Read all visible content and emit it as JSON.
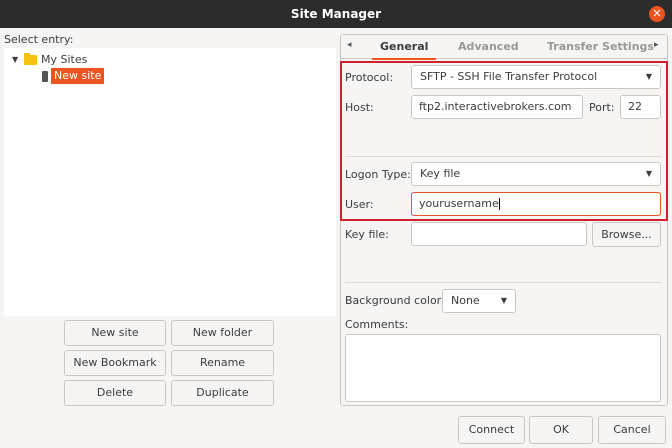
{
  "window": {
    "title": "Site Manager",
    "close_icon": "close-icon"
  },
  "left": {
    "label": "Select entry:",
    "tree": {
      "folder": "My Sites",
      "site": "New site"
    },
    "buttons": {
      "new_site": "New site",
      "new_folder": "New folder",
      "new_bookmark": "New Bookmark",
      "rename": "Rename",
      "delete": "Delete",
      "duplicate": "Duplicate"
    }
  },
  "tabs": {
    "prev_arrow": "◂",
    "next_arrow": "▸",
    "items": [
      "General",
      "Advanced",
      "Transfer Settings"
    ]
  },
  "general": {
    "protocol_label": "Protocol:",
    "protocol_value": "SFTP - SSH File Transfer Protocol",
    "host_label": "Host:",
    "host_value": "ftp2.interactivebrokers.com",
    "port_label": "Port:",
    "port_value": "22",
    "logon_label": "Logon Type:",
    "logon_value": "Key file",
    "user_label": "User:",
    "user_value": "yourusername",
    "keyfile_label": "Key file:",
    "keyfile_value": "",
    "browse": "Browse...",
    "bgcolor_label": "Background color:",
    "bgcolor_value": "None",
    "comments_label": "Comments:"
  },
  "footer": {
    "connect": "Connect",
    "ok": "OK",
    "cancel": "Cancel"
  },
  "colors": {
    "accent": "#e95420",
    "highlight": "#d1202d"
  }
}
